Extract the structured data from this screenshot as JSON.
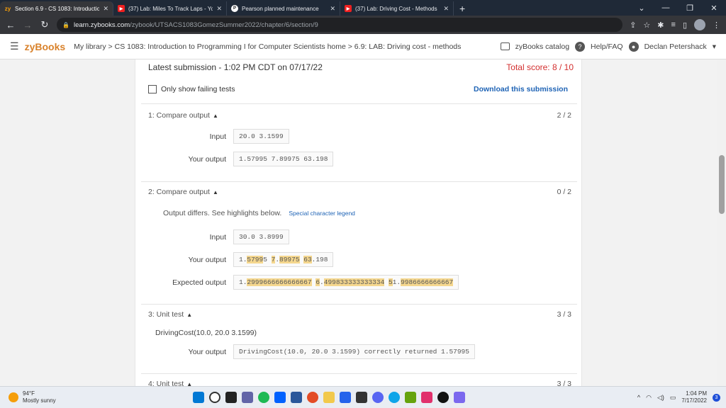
{
  "browser": {
    "tabs": [
      {
        "title": "Section 6.9 - CS 1083: Introductio",
        "favicon": "zy",
        "active": true
      },
      {
        "title": "(37) Lab: Miles To Track Laps - Yo",
        "favicon": "youtube",
        "active": false
      },
      {
        "title": "Pearson planned maintenance",
        "favicon": "pearson",
        "active": false
      },
      {
        "title": "(37) Lab: Driving Cost - Methods",
        "favicon": "youtube",
        "active": false
      }
    ],
    "url_host": "learn.zybooks.com",
    "url_path": "/zybook/UTSACS1083GomezSummer2022/chapter/6/section/9"
  },
  "header": {
    "logo": "zyBooks",
    "breadcrumb": "My library > CS 1083: Introduction to Programming I for Computer Scientists home > 6.9: LAB: Driving cost - methods",
    "catalog": "zyBooks catalog",
    "help": "Help/FAQ",
    "user": "Declan Petershack"
  },
  "submission": {
    "latest": "Latest submission - 1:02 PM CDT on 07/17/22",
    "total_score": "Total score: 8 / 10",
    "filter_label": "Only show failing tests",
    "download": "Download this submission"
  },
  "tests": [
    {
      "title": "1: Compare output",
      "score": "2 / 2",
      "input_label": "Input",
      "input": "20.0 3.1599",
      "your_label": "Your output",
      "your_output": "1.57995 7.89975 63.198"
    },
    {
      "title": "2: Compare output",
      "score": "0 / 2",
      "diff_msg": "Output differs. See highlights below.",
      "legend": "Special character legend",
      "input_label": "Input",
      "input": "30.0 3.8999",
      "your_label": "Your output",
      "your_segments": [
        "1.",
        "5799",
        "5",
        " ",
        "7",
        ".",
        "8",
        "9975",
        " ",
        "6",
        "3",
        ".198"
      ],
      "expected_label": "Expected output",
      "expected_segments": [
        "1.",
        "2999666666666667",
        " ",
        "6",
        ".",
        "4",
        "99833333333334",
        " ",
        "5",
        "1",
        ".",
        "9986666666667"
      ]
    },
    {
      "title": "3: Unit test",
      "score": "3 / 3",
      "desc": "DrivingCost(10.0, 20.0 3.1599)",
      "your_label": "Your output",
      "your_output": "DrivingCost(10.0, 20.0 3.1599) correctly returned 1.57995"
    },
    {
      "title": "4: Unit test",
      "score": "3 / 3"
    }
  ],
  "taskbar": {
    "temp": "94°F",
    "condition": "Mostly sunny",
    "time": "1:04 PM",
    "date": "7/17/2022",
    "notifications": "3"
  }
}
